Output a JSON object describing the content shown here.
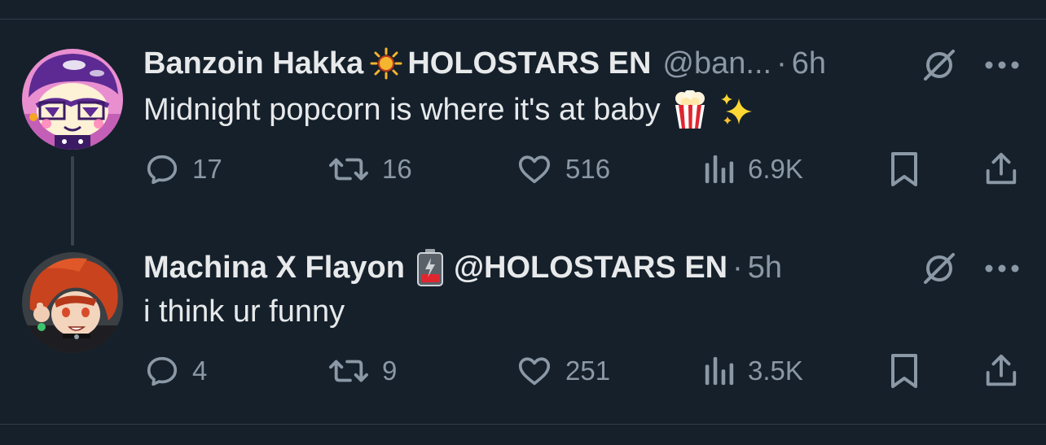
{
  "tweets": [
    {
      "display_name": "Banzoin Hakka",
      "name_emoji": "sun-emoji",
      "name_suffix": "HOLOSTARS EN",
      "handle": "@ban...",
      "dot": "·",
      "time": "6h",
      "text": "Midnight popcorn is where it's at baby",
      "text_emojis": [
        "popcorn-emoji",
        "sparkles-emoji"
      ],
      "replies": "17",
      "retweets": "16",
      "likes": "516",
      "views": "6.9K"
    },
    {
      "display_name": "Machina X Flayon",
      "name_emoji": "low-battery-emoji",
      "name_suffix": "@HOLOSTARS EN",
      "dot": "·",
      "time": "5h",
      "text": "i think ur funny",
      "replies": "4",
      "retweets": "9",
      "likes": "251",
      "views": "3.5K"
    }
  ],
  "colors": {
    "background": "#15202b",
    "primary_text": "#e7e9ea",
    "secondary_text": "#8b98a5",
    "divider": "#2f3b47",
    "thread_line": "#38444d"
  },
  "icons": {
    "reply": "reply-icon",
    "retweet": "retweet-icon",
    "like": "heart-icon",
    "views": "views-icon",
    "bookmark": "bookmark-icon",
    "share": "share-icon",
    "grok": "grok-icon",
    "more": "more-icon"
  }
}
